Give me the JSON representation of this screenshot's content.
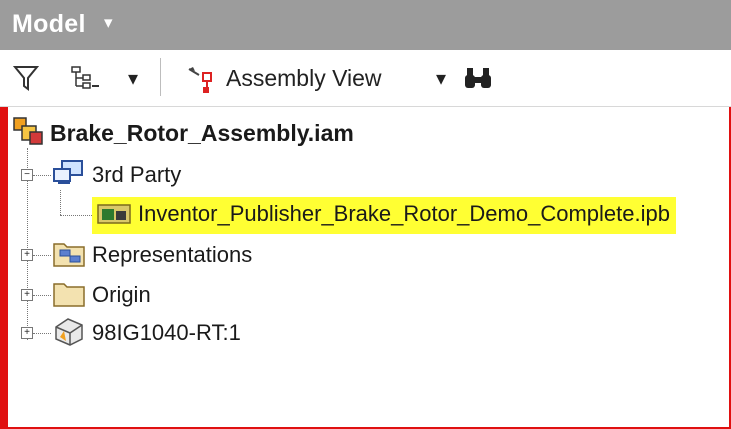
{
  "panel": {
    "title": "Model",
    "title_caret": "▾"
  },
  "toolbar": {
    "filter_icon": "filter-icon",
    "tree_options_icon": "tree-options-icon",
    "dropdown_caret": "▾",
    "view_icon": "assembly-view-icon",
    "view_label": "Assembly View",
    "view_caret": "▾",
    "find_icon": "binoculars-icon"
  },
  "tree": {
    "root": {
      "label": "Brake_Rotor_Assembly.iam",
      "icon": "assembly-icon"
    },
    "items": [
      {
        "label": "3rd Party",
        "icon": "third-party-icon",
        "expander": "−"
      },
      {
        "label": "Inventor_Publisher_Brake_Rotor_Demo_Complete.ipb",
        "icon": "publisher-file-icon",
        "highlight_color": "#ffff33"
      },
      {
        "label": "Representations",
        "icon": "representations-icon",
        "expander": "+"
      },
      {
        "label": "Origin",
        "icon": "folder-icon",
        "expander": "+"
      },
      {
        "label": "98IG1040-RT:1",
        "icon": "part-icon",
        "expander": "+"
      }
    ]
  },
  "colors": {
    "border": "#e01010",
    "titlebar": "#9c9c9c",
    "highlight": "#ffff33"
  }
}
